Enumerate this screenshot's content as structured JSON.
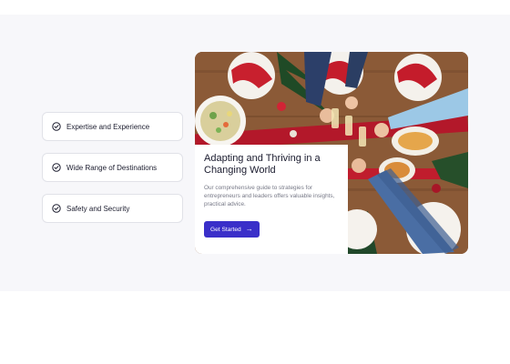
{
  "features": [
    {
      "label": "Expertise and Experience",
      "icon": "check-circle-icon"
    },
    {
      "label": "Wide Range of Destinations",
      "icon": "check-circle-icon"
    },
    {
      "label": "Safety and Security",
      "icon": "check-circle-icon"
    }
  ],
  "card": {
    "title": "Adapting and Thriving in a Changing World",
    "description": "Our comprehensive guide to strategies for entrepreneurs and leaders offers valuable insights, practical advice.",
    "cta_label": "Get Started",
    "cta_icon": "arrow-right-icon",
    "image_subject": "festive-dinner-table-toast",
    "colors": {
      "accent": "#3a2fc9",
      "card_bg": "#ffffff",
      "section_bg": "#f7f7fa"
    }
  }
}
